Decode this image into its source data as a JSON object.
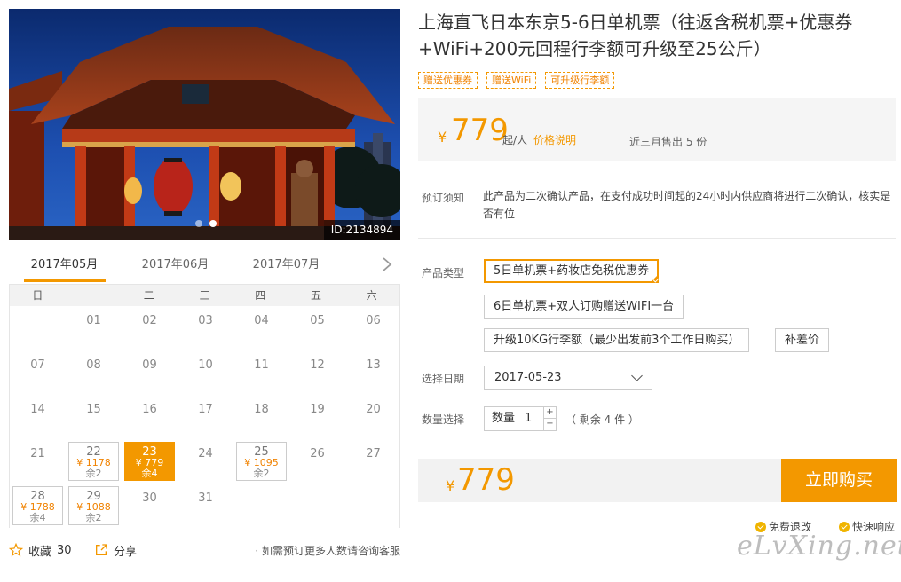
{
  "hero": {
    "image_id": "ID:2134894",
    "dot_count": 2,
    "active_dot": 1
  },
  "calendar": {
    "tabs": [
      "2017年05月",
      "2017年06月",
      "2017年07月"
    ],
    "active_tab": 0,
    "weekdays": [
      "日",
      "一",
      "二",
      "三",
      "四",
      "五",
      "六"
    ],
    "days": [
      {
        "d": ""
      },
      {
        "d": "01"
      },
      {
        "d": "02"
      },
      {
        "d": "03"
      },
      {
        "d": "04"
      },
      {
        "d": "05"
      },
      {
        "d": "06"
      },
      {
        "d": "07"
      },
      {
        "d": "08"
      },
      {
        "d": "09"
      },
      {
        "d": "10"
      },
      {
        "d": "11"
      },
      {
        "d": "12"
      },
      {
        "d": "13"
      },
      {
        "d": "14"
      },
      {
        "d": "15"
      },
      {
        "d": "16"
      },
      {
        "d": "17"
      },
      {
        "d": "18"
      },
      {
        "d": "19"
      },
      {
        "d": "20"
      },
      {
        "d": "21"
      },
      {
        "d": "22",
        "price": "¥ 1178",
        "stock": "余2"
      },
      {
        "d": "23",
        "price": "¥ 779",
        "stock": "余4",
        "selected": true
      },
      {
        "d": "24"
      },
      {
        "d": "25",
        "price": "¥ 1095",
        "stock": "余2"
      },
      {
        "d": "26"
      },
      {
        "d": "27"
      },
      {
        "d": "28",
        "price": "¥ 1788",
        "stock": "余4"
      },
      {
        "d": "29",
        "price": "¥ 1088",
        "stock": "余2"
      },
      {
        "d": "30"
      },
      {
        "d": "31"
      }
    ]
  },
  "footer_left": {
    "favorite_label": "收藏",
    "favorite_count": "30",
    "share_label": "分享",
    "hint": "· 如需预订更多人数请咨询客服"
  },
  "product": {
    "title": "上海直飞日本东京5-6日单机票（往返含税机票+优惠券+WiFi+200元回程行李额可升级至25公斤）",
    "tags": [
      "赠送优惠券",
      "赠送WiFi",
      "可升级行李额"
    ],
    "price": {
      "currency": "¥",
      "amount": "779",
      "unit": "起/人",
      "explain_link": "价格说明",
      "sold": "近三月售出 5 份"
    },
    "notice_label": "预订须知",
    "notice_text": "此产品为二次确认产品，在支付成功时间起的24小时内供应商将进行二次确认，核实是否有位",
    "type_label": "产品类型",
    "types": [
      "5日单机票+药妆店免税优惠券",
      "6日单机票+双人订购赠送WIFI一台",
      "升级10KG行李额（最少出发前3个工作日购买）",
      "补差价"
    ],
    "selected_type": 0,
    "date_label": "选择日期",
    "date_value": "2017-05-23",
    "qty_label": "数量选择",
    "qty_field_label": "数量",
    "qty_value": "1",
    "qty_plus": "+",
    "qty_minus": "−",
    "remain": "（ 剩余 4 件 ）",
    "total_currency": "¥",
    "total_amount": "779",
    "buy_label": "立即购买",
    "guarantees": [
      "免费退改",
      "快速响应"
    ]
  },
  "watermark": "eLvXing.net",
  "colors": {
    "accent": "#f39800",
    "price": "#f39800",
    "bar_bg": "#f2f2f2"
  }
}
